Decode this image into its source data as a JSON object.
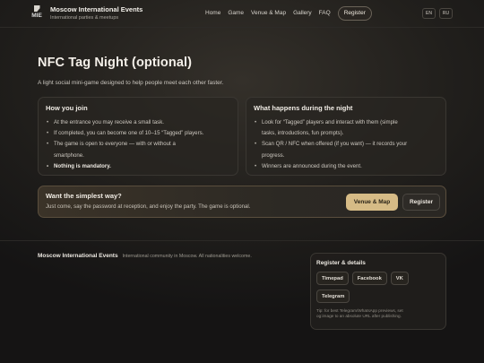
{
  "header": {
    "logo_text": "MIE",
    "brand_name": "Moscow International Events",
    "brand_sub": "International parties & meetups",
    "nav": [
      "Home",
      "Game",
      "Venue & Map",
      "Gallery",
      "FAQ"
    ],
    "register": "Register",
    "lang_en": "EN",
    "lang_ru": "RU"
  },
  "hero": {
    "title": "NFC Tag Night (optional)",
    "lead": "A light social mini-game designed to help people meet each other faster."
  },
  "join": {
    "heading": "How you join",
    "items": [
      "At the entrance you may receive a small task.",
      "If completed, you can become one of 10–15 “Tagged” players.",
      "The game is open to everyone — with or without a",
      "smartphone.",
      "Nothing is mandatory."
    ]
  },
  "night": {
    "heading": "What happens during the night",
    "items": [
      "Look for “Tagged” players and interact with them (simple",
      "tasks, introductions, fun prompts).",
      "Scan QR / NFC when offered (if you want) — it records your",
      "progress.",
      "Winners are announced during the event."
    ]
  },
  "cta": {
    "heading": "Want the simplest way?",
    "text": "Just come, say the password at reception, and enjoy the party. The game is optional.",
    "primary": "Venue & Map",
    "secondary": "Register"
  },
  "footer": {
    "name": "Moscow International Events",
    "tagline": "International community in Moscow. All nationalities welcome.",
    "panel_heading": "Register & details",
    "links": [
      "Timepad",
      "Facebook",
      "VK",
      "Telegram"
    ],
    "tip_line1": "Tip: for best Telegram/WhatsApp previews, set",
    "tip_line2": "og:image to an absolute URL after publishing."
  }
}
